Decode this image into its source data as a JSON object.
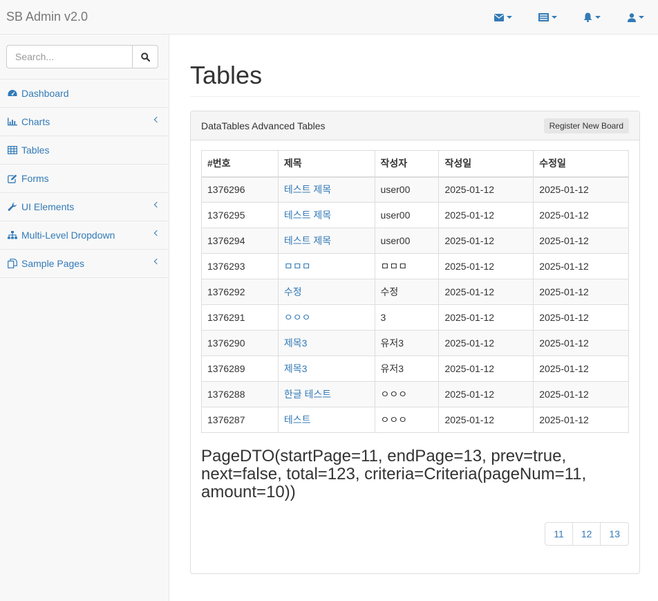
{
  "navbar": {
    "brand": "SB Admin v2.0",
    "icons": [
      "envelope-icon",
      "tasks-icon",
      "bell-icon",
      "user-icon"
    ]
  },
  "sidebar": {
    "search_placeholder": "Search...",
    "items": [
      {
        "label": "Dashboard",
        "icon": "dashboard-icon",
        "expandable": false
      },
      {
        "label": "Charts",
        "icon": "bar-chart-icon",
        "expandable": true
      },
      {
        "label": "Tables",
        "icon": "table-icon",
        "expandable": false
      },
      {
        "label": "Forms",
        "icon": "edit-icon",
        "expandable": false
      },
      {
        "label": "UI Elements",
        "icon": "wrench-icon",
        "expandable": true
      },
      {
        "label": "Multi-Level Dropdown",
        "icon": "sitemap-icon",
        "expandable": true
      },
      {
        "label": "Sample Pages",
        "icon": "files-icon",
        "expandable": true
      }
    ]
  },
  "main": {
    "title": "Tables",
    "panel": {
      "heading": "DataTables Advanced Tables",
      "register_button": "Register New Board"
    },
    "table": {
      "columns": [
        "#번호",
        "제목",
        "작성자",
        "작성일",
        "수정일"
      ],
      "rows": [
        [
          "1376296",
          "테스트 제목",
          "user00",
          "2025-01-12",
          "2025-01-12"
        ],
        [
          "1376295",
          "테스트 제목",
          "user00",
          "2025-01-12",
          "2025-01-12"
        ],
        [
          "1376294",
          "테스트 제목",
          "user00",
          "2025-01-12",
          "2025-01-12"
        ],
        [
          "1376293",
          "ㅁㅁㅁ",
          "ㅁㅁㅁ",
          "2025-01-12",
          "2025-01-12"
        ],
        [
          "1376292",
          "수정",
          "수정",
          "2025-01-12",
          "2025-01-12"
        ],
        [
          "1376291",
          "ㅇㅇㅇ",
          "3",
          "2025-01-12",
          "2025-01-12"
        ],
        [
          "1376290",
          "제목3",
          "유저3",
          "2025-01-12",
          "2025-01-12"
        ],
        [
          "1376289",
          "제목3",
          "유저3",
          "2025-01-12",
          "2025-01-12"
        ],
        [
          "1376288",
          "한글 테스트",
          "ㅇㅇㅇ",
          "2025-01-12",
          "2025-01-12"
        ],
        [
          "1376287",
          "테스트",
          "ㅇㅇㅇ",
          "2025-01-12",
          "2025-01-12"
        ]
      ]
    },
    "page_dto": "PageDTO(startPage=11, endPage=13, prev=true, next=false, total=123, criteria=Criteria(pageNum=11, amount=10))",
    "pagination": [
      "11",
      "12",
      "13"
    ]
  },
  "colors": {
    "link": "#337ab7",
    "navbar_bg": "#f8f8f8",
    "border": "#dddddd"
  }
}
